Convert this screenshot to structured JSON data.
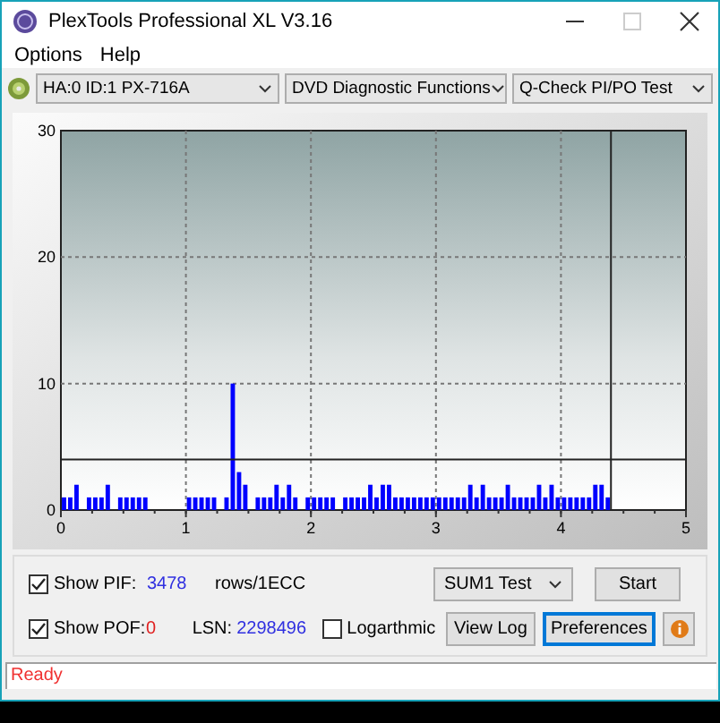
{
  "window": {
    "title": "PlexTools Professional XL V3.16"
  },
  "menu": [
    {
      "label": "Options"
    },
    {
      "label": "Help"
    }
  ],
  "toolbar": {
    "drive": "HA:0 ID:1  PX-716A",
    "function": "DVD Diagnostic Functions",
    "test": "Q-Check PI/PO Test"
  },
  "chart": {
    "chart_data": {
      "type": "bar",
      "xlim": [
        0,
        5
      ],
      "ylim": [
        0,
        30
      ],
      "xticks": [
        0,
        1,
        2,
        3,
        4,
        5
      ],
      "yticks": [
        0,
        10,
        20,
        30
      ],
      "grid": true,
      "x": [
        0.025,
        0.075,
        0.125,
        0.225,
        0.275,
        0.325,
        0.375,
        0.475,
        0.525,
        0.575,
        0.625,
        0.675,
        1.025,
        1.075,
        1.125,
        1.175,
        1.225,
        1.325,
        1.375,
        1.425,
        1.475,
        1.575,
        1.625,
        1.675,
        1.725,
        1.775,
        1.825,
        1.875,
        1.975,
        2.025,
        2.075,
        2.125,
        2.175,
        2.275,
        2.325,
        2.375,
        2.425,
        2.475,
        2.525,
        2.575,
        2.625,
        2.675,
        2.725,
        2.775,
        2.825,
        2.875,
        2.925,
        2.975,
        3.025,
        3.075,
        3.125,
        3.175,
        3.225,
        3.275,
        3.325,
        3.375,
        3.425,
        3.475,
        3.525,
        3.575,
        3.625,
        3.675,
        3.725,
        3.775,
        3.825,
        3.875,
        3.925,
        3.975,
        4.025,
        4.075,
        4.125,
        4.175,
        4.225,
        4.275,
        4.325,
        4.375
      ],
      "series": [
        {
          "color": "#0000ff",
          "values": [
            1,
            1,
            2,
            1,
            1,
            1,
            2,
            1,
            1,
            1,
            1,
            1,
            1,
            1,
            1,
            1,
            1,
            1,
            10,
            3,
            2,
            1,
            1,
            1,
            2,
            1,
            2,
            1,
            1,
            1,
            1,
            1,
            1,
            1,
            1,
            1,
            1,
            2,
            1,
            2,
            2,
            1,
            1,
            1,
            1,
            1,
            1,
            1,
            1,
            1,
            1,
            1,
            1,
            2,
            1,
            2,
            1,
            1,
            1,
            2,
            1,
            1,
            1,
            1,
            2,
            1,
            2,
            1,
            1,
            1,
            1,
            1,
            1,
            2,
            2,
            1
          ]
        }
      ],
      "ref_lines": [
        {
          "axis": "y",
          "value": 4
        },
        {
          "axis": "x",
          "value": 4.4
        }
      ]
    }
  },
  "controls": {
    "show_pif": {
      "label": "Show PIF:",
      "checked": true,
      "value": "3478"
    },
    "units": "rows/1ECC",
    "test_select": "SUM1 Test",
    "start": "Start",
    "show_pof": {
      "label": "Show POF:",
      "checked": true,
      "value": "0"
    },
    "lsn_label": "LSN:",
    "lsn_value": "2298496",
    "logarithmic": {
      "label": "Logarthmic",
      "checked": false
    },
    "view_log": "View Log",
    "preferences": {
      "label": "Preferences",
      "selected": true
    }
  },
  "status_bar": "Ready"
}
